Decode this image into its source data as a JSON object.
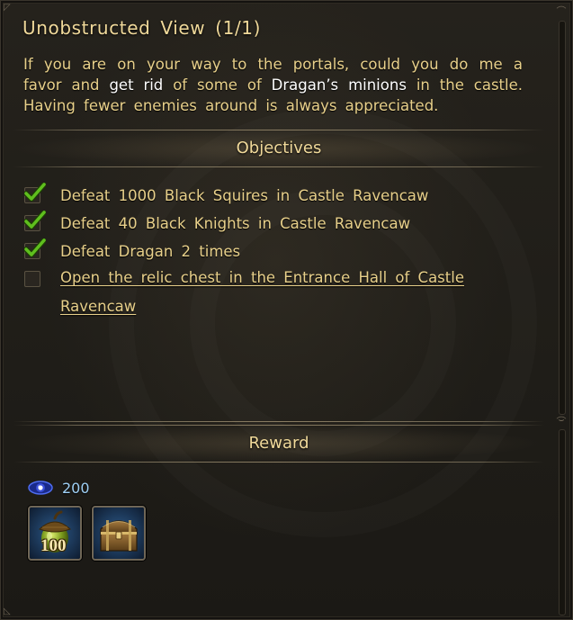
{
  "quest": {
    "title": "Unobstructed View (1/1)",
    "description": {
      "part1": "If you are on your way to the portals, could you do me a favor and ",
      "highlight1": "get rid",
      "part2": " of some of ",
      "highlight2": "Dragan’s minions",
      "part3": " in the castle. Having fewer enemies around is always appreciated."
    }
  },
  "objectives": {
    "header": "Objectives",
    "items": [
      {
        "text": "Defeat 1000 Black Squires in Castle Ravencaw",
        "completed": true
      },
      {
        "text": "Defeat 40 Black Knights in Castle Ravencaw",
        "completed": true
      },
      {
        "text": "Defeat Dragan 2 times",
        "completed": true
      },
      {
        "text_line1": "Open the relic chest in the Entrance Hall of Castle",
        "text_line2": "Ravencaw",
        "completed": false
      }
    ]
  },
  "reward": {
    "header": "Reward",
    "xp_value": "200",
    "xp_icon": "eye-orb-icon",
    "items": [
      {
        "icon": "acorn-icon",
        "count": "100"
      },
      {
        "icon": "treasure-chest-icon"
      }
    ]
  },
  "colors": {
    "title": "#f0d99a",
    "text": "#e8d08a",
    "highlight": "#ffffff",
    "xp": "#9fd0f5",
    "check": "#5fbf1e"
  }
}
